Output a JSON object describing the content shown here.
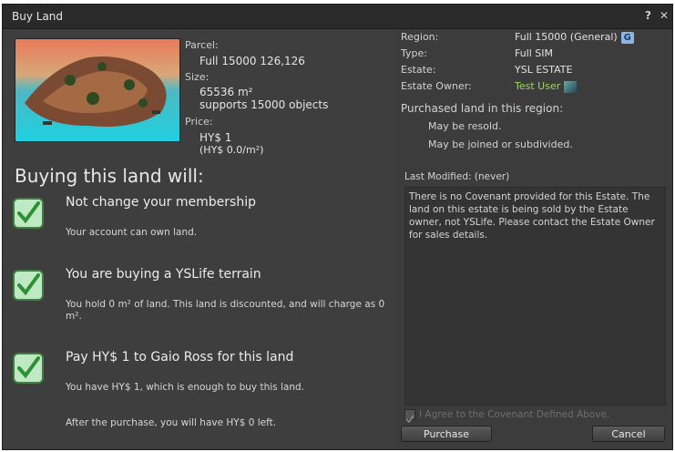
{
  "window": {
    "title": "Buy Land",
    "help_label": "?",
    "close_label": "✕"
  },
  "parcel": {
    "parcel_label": "Parcel:",
    "parcel_value": "Full  15000 126,126",
    "size_label": "Size:",
    "size_value": "65536 m²",
    "objects_value": "supports 15000 objects",
    "price_label": "Price:",
    "price_value": "HY$ 1",
    "price_per_m": "(HY$ 0.0/m²)"
  },
  "heading": "Buying this land will:",
  "items": [
    {
      "title": "Not change your membership",
      "desc": "Your account can own land."
    },
    {
      "title": "You are buying a YSLife terrain",
      "desc": "You hold 0 m² of land. This land is discounted, and will charge as 0 m²."
    },
    {
      "title": "Pay HY$ 1 to Gaio Ross for this land",
      "desc": "You have HY$ 1, which is enough to buy this land.",
      "desc2": "After the purchase, you will have HY$ 0 left."
    }
  ],
  "region_info": {
    "region_label": "Region:",
    "region_value": "Full  15000 (General)",
    "region_badge": "G",
    "type_label": "Type:",
    "type_value": "Full SIM",
    "estate_label": "Estate:",
    "estate_value": "YSL ESTATE",
    "owner_label": "Estate Owner:",
    "owner_value": "Test User",
    "owner_color": "#9fd55e"
  },
  "purchased": {
    "heading": "Purchased land in this region:",
    "resold": "May be resold.",
    "joined": "May be joined or subdivided."
  },
  "covenant": {
    "last_modified": "Last Modified:  (never)",
    "text": "There is no Covenant provided for this Estate. The land on this estate is being sold by the Estate owner, not YSLife.  Please contact the Estate Owner for sales details.",
    "agree_label": "I Agree to the Covenant Defined Above."
  },
  "buttons": {
    "purchase": "Purchase",
    "cancel": "Cancel"
  }
}
